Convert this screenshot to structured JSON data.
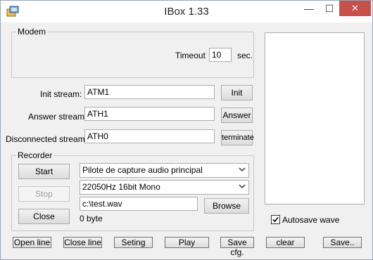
{
  "window": {
    "title": "IBox 1.33"
  },
  "titlebar": {
    "minimize": "—",
    "maximize": "☐",
    "close": "✕"
  },
  "modem": {
    "legend": "Modem",
    "timeout_label": "Timeout",
    "timeout_value": "10",
    "timeout_unit": "sec."
  },
  "streams": {
    "init_label": "Init stream:",
    "init_value": "ATM1",
    "init_button": "Init",
    "answer_label": "Answer stream:",
    "answer_value": "ATH1",
    "answer_button": "Answer",
    "disconnected_label": "Disconnected stream:",
    "disconnected_value": "ATH0",
    "disconnected_button": "terminate"
  },
  "recorder": {
    "legend": "Recorder",
    "start": "Start",
    "stop": "Stop",
    "close": "Close",
    "device_selected": "Pilote de capture audio principal",
    "format_selected": "22050Hz 16bit Mono",
    "file_path": "c:\\test.wav",
    "browse": "Browse",
    "size": "0 byte"
  },
  "autosave": {
    "label": "Autosave wave",
    "checked": true
  },
  "bottom_buttons": {
    "open_line": "Open line",
    "close_line": "Close line",
    "seting": "Seting",
    "play": "Play",
    "save_cfg": "Save cfg.",
    "clear": "clear",
    "save": "Save.."
  }
}
